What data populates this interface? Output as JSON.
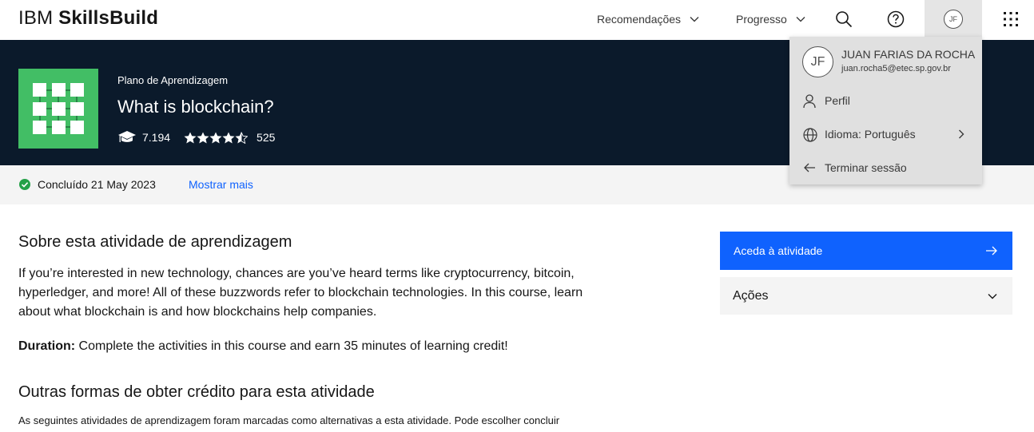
{
  "header": {
    "brand_ibm": "IBM",
    "brand_name": "SkillsBuild",
    "nav": [
      {
        "label": "Recomendações"
      },
      {
        "label": "Progresso"
      }
    ],
    "avatar_initials": "JF"
  },
  "hero": {
    "eyebrow": "Plano de Aprendizagem",
    "title": "What is blockchain?",
    "learners": "7.194",
    "rating": 4.5,
    "rating_count": "525",
    "tile_color": "#42be65",
    "background": "#0b1a2b"
  },
  "status": {
    "completed_text": "Concluído 21 May 2023",
    "show_more": "Mostrar mais"
  },
  "about": {
    "heading": "Sobre esta atividade de aprendizagem",
    "paragraph": "If you’re interested in new technology, chances are you’ve heard terms like cryptocurrency, bitcoin, hyperledger, and more! All of these buzzwords refer to blockchain technologies. In this course, learn about what blockchain is and how blockchains help companies.",
    "duration_label": "Duration:",
    "duration_text": " Complete the activities in this course and earn 35 minutes of learning credit!"
  },
  "other": {
    "heading": "Outras formas de obter crédito para esta atividade",
    "paragraph": "As seguintes atividades de aprendizagem foram marcadas como alternativas a esta atividade. Pode escolher concluir"
  },
  "panel": {
    "cta_label": "Aceda à atividade",
    "actions_label": "Ações",
    "accent": "#0f62fe"
  },
  "menu": {
    "initials": "JF",
    "name": "JUAN FARIAS DA ROCHA",
    "email": "juan.rocha5@etec.sp.gov.br",
    "items": [
      {
        "label": "Perfil",
        "icon": "user-icon"
      },
      {
        "label": "Idioma: Português",
        "icon": "globe-icon"
      },
      {
        "label": "Terminar sessão",
        "icon": "arrow-left-icon"
      }
    ]
  }
}
